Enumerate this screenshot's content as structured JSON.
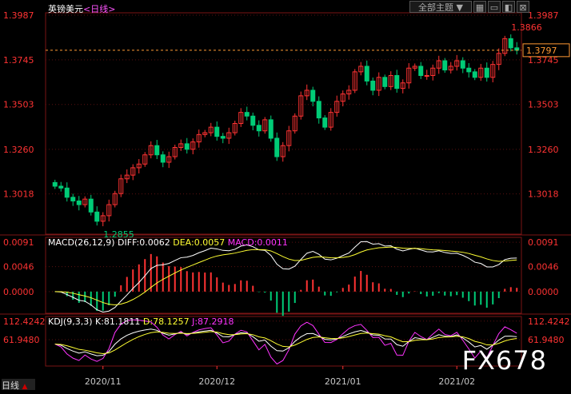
{
  "header": {
    "instrument": "英镑美元",
    "period": "<日线>",
    "theme_button": "全部主题 ▼",
    "grid_icon": "grid-icon",
    "window_icon": "window-icon",
    "collapse_icon": "collapse-icon",
    "close_icon": "close-icon"
  },
  "colors": {
    "up": "#ff3333",
    "down": "#00cc77",
    "ma": "#ffffff",
    "signal": "#ffff33",
    "j": "#ff33ff",
    "axis": "#ff3333",
    "grid": "#5a1010"
  },
  "chart_data": [
    {
      "type": "candlestick",
      "title": "英镑美元<日线>",
      "y_ticks": [
        "1.3987",
        "1.3745",
        "1.3503",
        "1.3260",
        "1.3018"
      ],
      "ylim": [
        1.28,
        1.4
      ],
      "x_ticks": [
        "2020/11",
        "2020/12",
        "2021/01",
        "2021/02"
      ],
      "high_label": "1.3866",
      "low_label": "1.2855",
      "current_price": "1.3797",
      "closes": [
        1.306,
        1.305,
        1.3,
        1.298,
        1.296,
        1.299,
        1.292,
        1.287,
        1.29,
        1.296,
        1.302,
        1.31,
        1.312,
        1.316,
        1.318,
        1.323,
        1.328,
        1.323,
        1.319,
        1.322,
        1.327,
        1.329,
        1.326,
        1.33,
        1.334,
        1.335,
        1.338,
        1.333,
        1.332,
        1.335,
        1.34,
        1.346,
        1.344,
        1.339,
        1.336,
        1.342,
        1.332,
        1.322,
        1.328,
        1.336,
        1.344,
        1.355,
        1.358,
        1.352,
        1.343,
        1.338,
        1.346,
        1.352,
        1.356,
        1.358,
        1.368,
        1.371,
        1.363,
        1.358,
        1.365,
        1.36,
        1.366,
        1.359,
        1.362,
        1.37,
        1.371,
        1.366,
        1.366,
        1.37,
        1.374,
        1.369,
        1.371,
        1.374,
        1.37,
        1.368,
        1.365,
        1.37,
        1.365,
        1.372,
        1.378,
        1.386,
        1.381,
        1.3797
      ],
      "macd": {
        "label": "MACD(26,12,9)",
        "diff": "DIFF:0.0062",
        "dea": "DEA:0.0057",
        "macd": "MACD:0.0011",
        "y_ticks": [
          "0.0091",
          "0.0046",
          "0.0000"
        ]
      },
      "kdj": {
        "label": "KDJ(9,3,3)",
        "k": "K:81.1811",
        "d": "D:78.1257",
        "j": "J:87.2918",
        "y_ticks": [
          "112.4242",
          "61.9480"
        ]
      }
    }
  ],
  "footer": {
    "range_label": "日线"
  },
  "watermark": "FX678"
}
